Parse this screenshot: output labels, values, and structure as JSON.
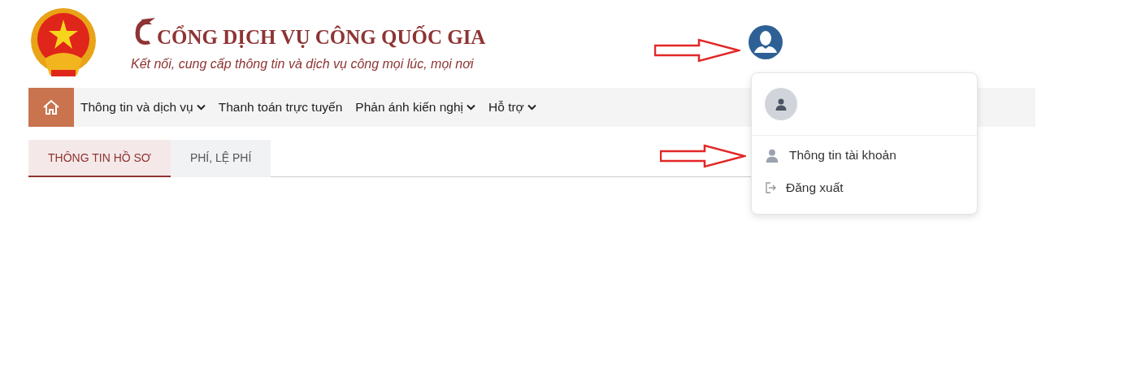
{
  "header": {
    "title": "CỔNG DỊCH VỤ CÔNG QUỐC GIA",
    "subtitle": "Kết nối, cung cấp thông tin và dịch vụ công mọi lúc, mọi nơi"
  },
  "nav": [
    {
      "label": "Thông tin và dịch vụ",
      "dropdown": true
    },
    {
      "label": "Thanh toán trực tuyến",
      "dropdown": false
    },
    {
      "label": "Phản ánh kiến nghị",
      "dropdown": true
    },
    {
      "label": "Hỗ trợ",
      "dropdown": true
    }
  ],
  "tabs": [
    {
      "label": "THÔNG TIN HỒ SƠ",
      "selected": true
    },
    {
      "label": "PHÍ, LỆ PHÍ",
      "selected": false
    }
  ],
  "account_menu": {
    "open": true,
    "items": [
      {
        "kind": "profile",
        "label": "Thông tin tài khoản"
      },
      {
        "kind": "logout",
        "label": "Đăng xuất"
      }
    ]
  }
}
